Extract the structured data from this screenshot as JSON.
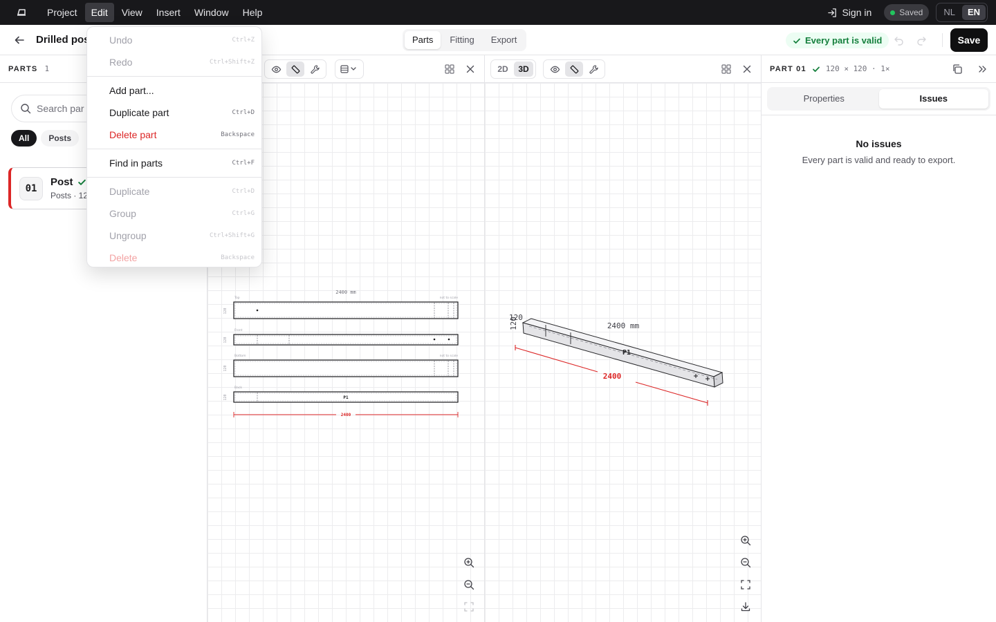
{
  "menubar": {
    "menus": [
      "Project",
      "Edit",
      "View",
      "Insert",
      "Window",
      "Help"
    ],
    "active_menu": "Edit",
    "sign_in": "Sign in",
    "saved": "Saved",
    "languages": [
      "NL",
      "EN"
    ],
    "active_language": "EN"
  },
  "toolbar": {
    "title": "Drilled pos",
    "modes": [
      "Parts",
      "Fitting",
      "Export"
    ],
    "active_mode": "Parts",
    "status": "Every part is valid",
    "save_label": "Save"
  },
  "sidebar": {
    "heading": "PARTS",
    "count": "1",
    "search_placeholder": "Search par",
    "filters": [
      "All",
      "Posts"
    ],
    "active_filter": "All",
    "parts": [
      {
        "number": "01",
        "name": "Post",
        "subtitle": "Posts · 12",
        "valid": true
      }
    ]
  },
  "edit_menu": {
    "groups": [
      [
        {
          "label": "Undo",
          "shortcut": "Ctrl+Z",
          "disabled": true
        },
        {
          "label": "Redo",
          "shortcut": "Ctrl+Shift+Z",
          "disabled": true
        }
      ],
      [
        {
          "label": "Add part...",
          "shortcut": "",
          "disabled": false
        },
        {
          "label": "Duplicate part",
          "shortcut": "Ctrl+D",
          "disabled": false
        },
        {
          "label": "Delete part",
          "shortcut": "Backspace",
          "disabled": false,
          "danger": true
        }
      ],
      [
        {
          "label": "Find in parts",
          "shortcut": "Ctrl+F",
          "disabled": false
        }
      ],
      [
        {
          "label": "Duplicate",
          "shortcut": "Ctrl+D",
          "disabled": true
        },
        {
          "label": "Group",
          "shortcut": "Ctrl+G",
          "disabled": true
        },
        {
          "label": "Ungroup",
          "shortcut": "Ctrl+Shift+G",
          "disabled": true
        },
        {
          "label": "Delete",
          "shortcut": "Backspace",
          "disabled": true,
          "danger": true
        }
      ]
    ]
  },
  "view2d": {
    "top_dim": "2400 mm",
    "bottom_dim": "2400",
    "height_label": "120",
    "views": [
      "Top",
      "Front",
      "Bottom",
      "Back"
    ],
    "scale_note": "not to scale",
    "part_label": "P1"
  },
  "view3d": {
    "modes": [
      "2D",
      "3D"
    ],
    "active_mode": "3D",
    "length_dim": "2400 mm",
    "bottom_dim": "2400",
    "width_label": "120",
    "height_label": "120",
    "part_label": "P1"
  },
  "right_panel": {
    "heading": "PART 01",
    "dims": "120 × 120 · 1×",
    "tabs": [
      "Properties",
      "Issues"
    ],
    "active_tab": "Issues",
    "empty_title": "No issues",
    "empty_text": "Every part is valid and ready to export."
  },
  "colors": {
    "accent_red": "#dc2626",
    "valid_green": "#15803d",
    "menubar_bg": "#18181b"
  }
}
